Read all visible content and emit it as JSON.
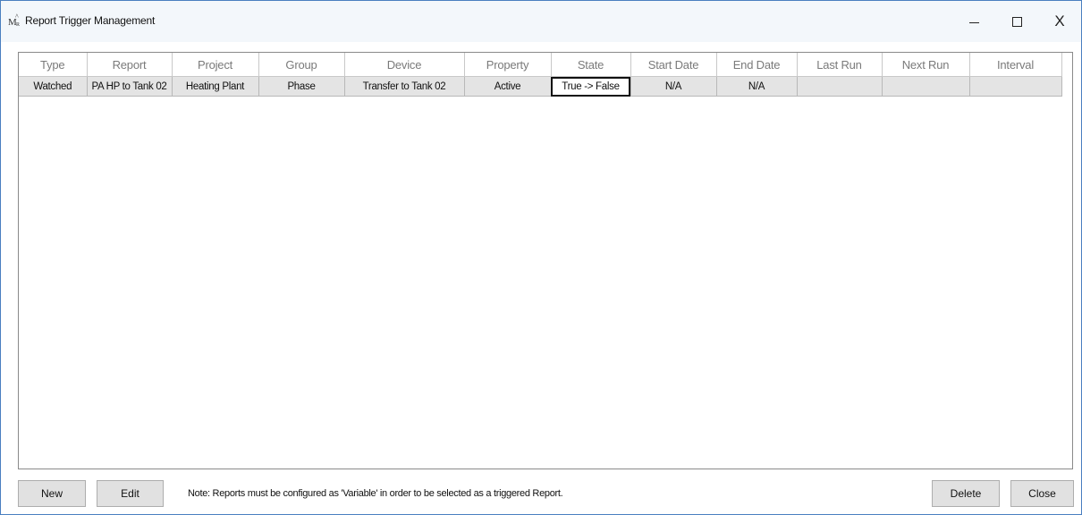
{
  "window": {
    "title": "Report Trigger Management",
    "icon_text": {
      "m": "M",
      "a": "^",
      "r": "R"
    },
    "controls": {
      "minimize": "minimize-icon",
      "maximize": "maximize-icon",
      "close": "X"
    }
  },
  "table": {
    "columns": [
      "Type",
      "Report",
      "Project",
      "Group",
      "Device",
      "Property",
      "State",
      "Start Date",
      "End Date",
      "Last Run",
      "Next Run",
      "Interval"
    ],
    "rows": [
      [
        "Watched",
        "PA HP to Tank 02",
        "Heating Plant",
        "Phase",
        "Transfer to Tank 02",
        "Active",
        "True -> False",
        "N/A",
        "N/A",
        "",
        "",
        ""
      ]
    ],
    "selected_cell": {
      "row": 0,
      "column": 6
    }
  },
  "footer": {
    "new_label": "New",
    "edit_label": "Edit",
    "note": "Note: Reports must be configured as 'Variable' in order to be selected as a triggered Report.",
    "delete_label": "Delete",
    "close_label": "Close"
  },
  "colors": {
    "window_border": "#4a7fc0",
    "titlebar_bg": "#f3f7fb",
    "row_bg": "#e4e4e4",
    "header_text": "#7a7a7a",
    "button_bg": "#e1e1e1"
  }
}
